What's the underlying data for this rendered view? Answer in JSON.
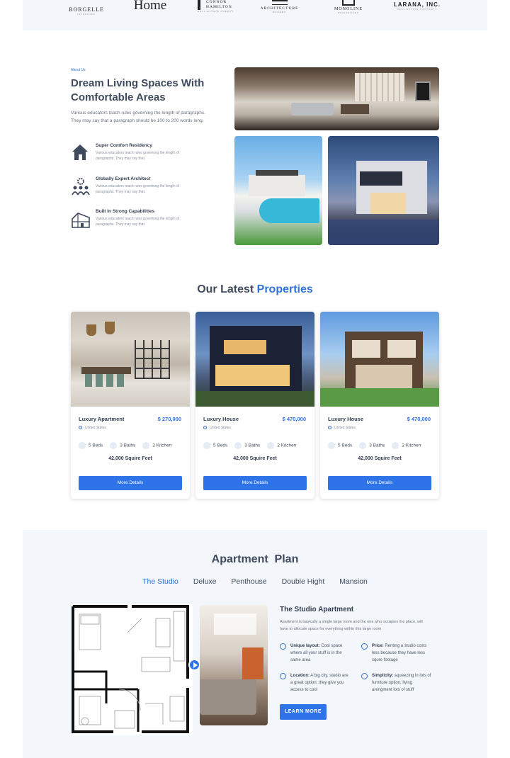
{
  "logos": [
    {
      "name": "BORGELLE",
      "sub": "INTERIORS"
    },
    {
      "name": "Home",
      "sub": ""
    },
    {
      "name": "CONNOR HAMILTON",
      "sub": "REAL ESTATE AGENCY"
    },
    {
      "name": "ARCHITECTURE",
      "sub": "MODERN"
    },
    {
      "name": "MONOLINE",
      "sub": "RESIDENCES"
    },
    {
      "name": "LARANA, INC.",
      "sub": "REAL ESTATE PROPERTY"
    }
  ],
  "about": {
    "eyebrow": "About Us",
    "title": "Dream Living Spaces With Comfortable Areas",
    "description": "Various educators teach rules governing the length of paragraphs. They may say that a paragraph should be 100 to 200 words long.",
    "features": [
      {
        "title": "Super Comfort Residency",
        "text": "Various educators teach rules governing the length of paragraphs. They may say that.",
        "icon": "house-icon"
      },
      {
        "title": "Globally Expert Architect",
        "text": "Various educators teach rules governing the length of paragraphs. They may say that.",
        "icon": "team-gear-icon"
      },
      {
        "title": "Built In Strong Capabilities",
        "text": "Various educators teach rules governing the length of paragraphs. They may say that.",
        "icon": "building-icon"
      }
    ]
  },
  "properties": {
    "title_plain": "Our Latest",
    "title_accent": "Properties",
    "cards": [
      {
        "name": "Luxury Apartment",
        "price": "$ 270,000",
        "location": "United States",
        "beds": "5 Beds",
        "baths": "3 Baths",
        "kitchen": "2 Kitchen",
        "area": "42,000 Squire Feet",
        "button": "More Details"
      },
      {
        "name": "Luxury House",
        "price": "$ 470,000",
        "location": "United States",
        "beds": "5 Beds",
        "baths": "3 Baths",
        "kitchen": "2 Kitchen",
        "area": "42,000 Squire Feet",
        "button": "More Details"
      },
      {
        "name": "Luxury House",
        "price": "$ 470,000",
        "location": "United States",
        "beds": "5 Beds",
        "baths": "3 Baths",
        "kitchen": "2 Kitchen",
        "area": "42,000 Squire Feet",
        "button": "More Details"
      }
    ]
  },
  "plan": {
    "title": "Apartment  Plan",
    "tabs": [
      "The Studio",
      "Deluxe",
      "Penthouse",
      "Double Hight",
      "Mansion"
    ],
    "active_tab": "The Studio",
    "studio_title": "The Studio Apartment",
    "studio_desc": "Apartment is basically a single large room and the one who occupies the place, will have to allocate space for everything within this large room",
    "bullets": [
      {
        "label": "Unique layout:",
        "text": "Cool space where all your stuff is in the same area"
      },
      {
        "label": "Price:",
        "text": "Renting a studio costs less because they have less squre footage"
      },
      {
        "label": "Location:",
        "text": "A big city, studio are a great option; they give you access  to cool"
      },
      {
        "label": "Simplicity:",
        "text": "squeezing in lots of furniture option, living arengment lots of stuff"
      }
    ],
    "learn_more": "LEARN MORE"
  },
  "colors": {
    "accent": "#2f73d8",
    "button": "#2f73e8",
    "section_bg": "#f3f7fc",
    "heading": "#3f4a5d"
  }
}
